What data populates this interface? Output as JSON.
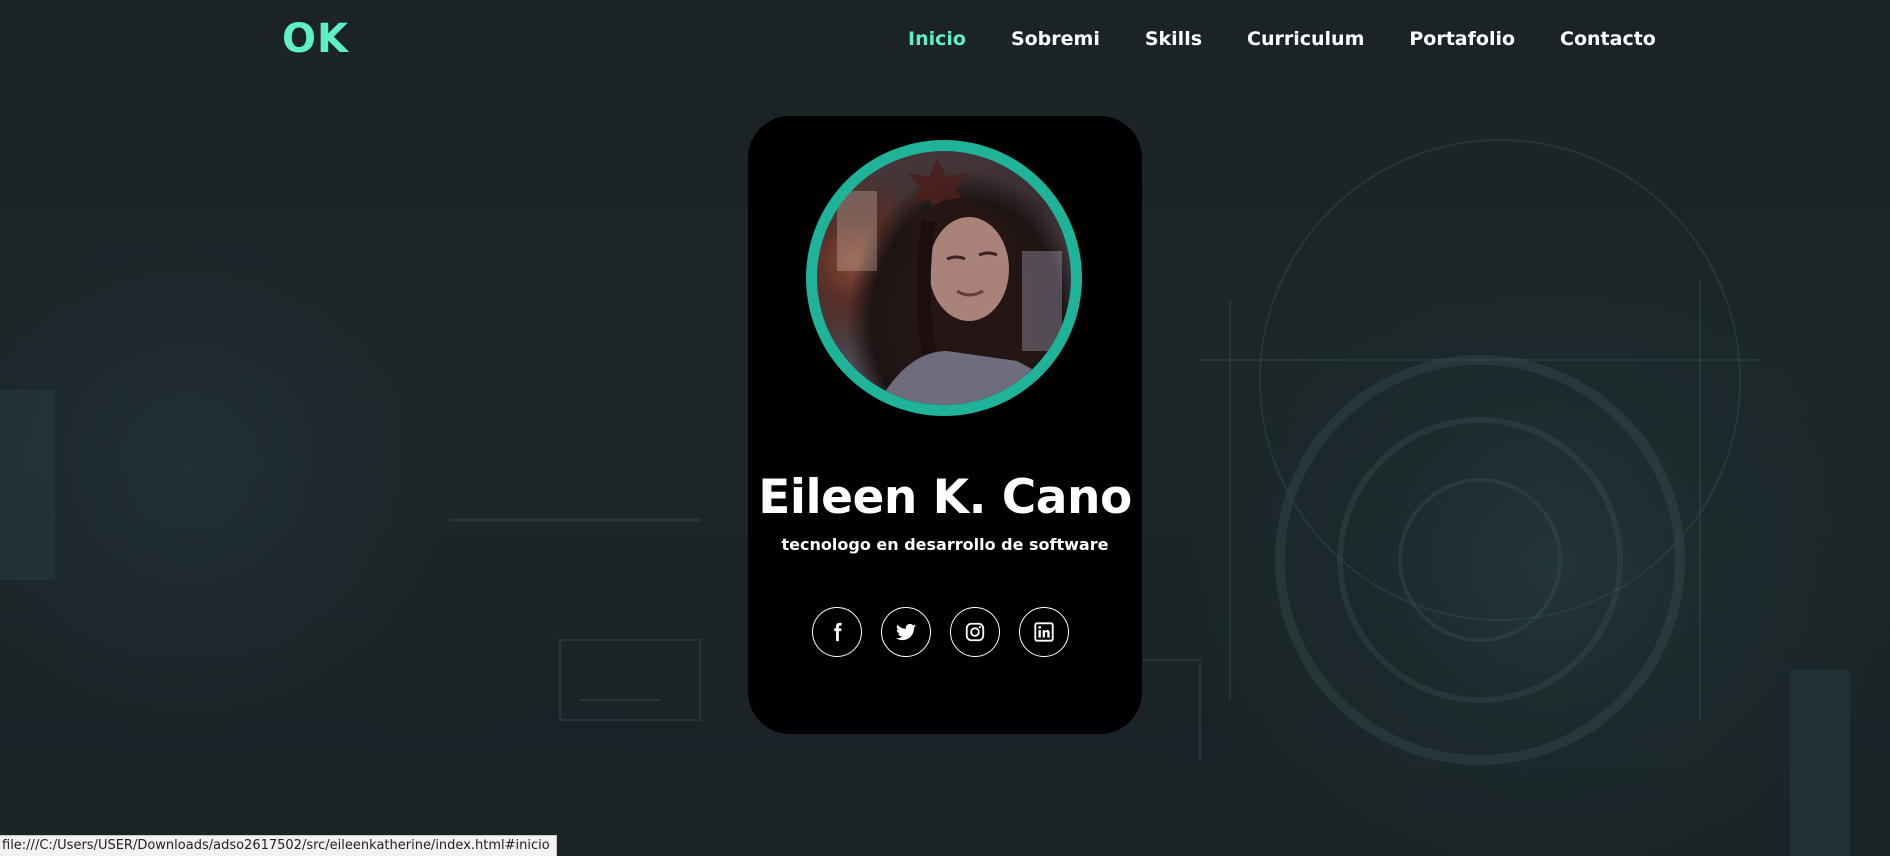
{
  "header": {
    "logo": "OK",
    "nav": [
      {
        "label": "Inicio",
        "active": true
      },
      {
        "label": "Sobremi",
        "active": false
      },
      {
        "label": "Skills",
        "active": false
      },
      {
        "label": "Curriculum",
        "active": false
      },
      {
        "label": "Portafolio",
        "active": false
      },
      {
        "label": "Contacto",
        "active": false
      }
    ]
  },
  "profile": {
    "name": "Eileen K. Cano",
    "role": "tecnologo en desarrollo de software",
    "photo_icon": "profile-photo"
  },
  "socials": [
    {
      "icon": "facebook-icon"
    },
    {
      "icon": "twitter-icon"
    },
    {
      "icon": "instagram-icon"
    },
    {
      "icon": "linkedin-icon"
    }
  ],
  "status_bar": {
    "url": "file:///C:/Users/USER/Downloads/adso2617502/src/eileenkatherine/index.html#inicio"
  },
  "colors": {
    "accent": "#5ff0c6",
    "ring": "#1fb39a",
    "card": "#000000",
    "background": "#1c2629"
  }
}
